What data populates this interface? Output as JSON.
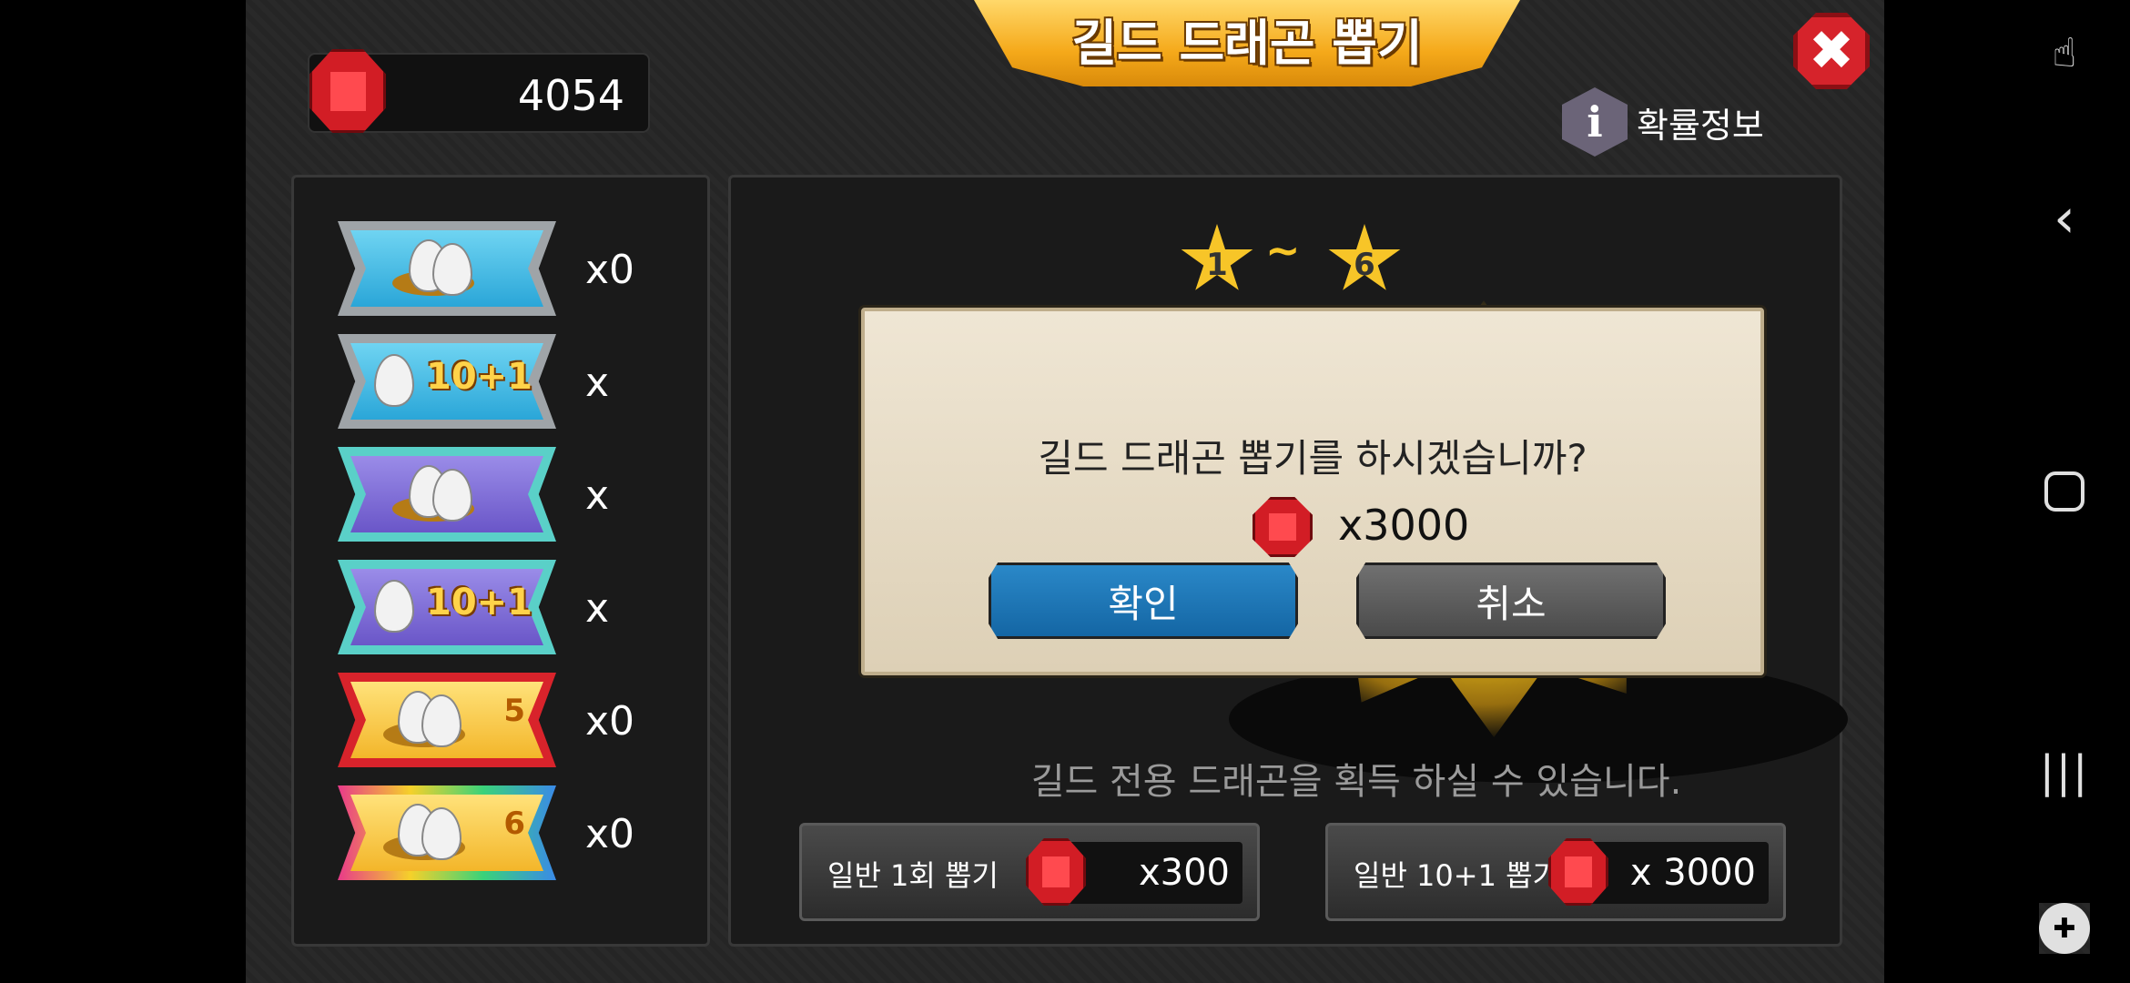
{
  "header": {
    "title": "길드 드래곤 뽑기",
    "close_label": "✖",
    "info_label": "확률정보",
    "info_icon_glyph": "i"
  },
  "currency": {
    "gem_count": "4054"
  },
  "tickets": [
    {
      "type": "single",
      "theme": "blue",
      "count": "x0"
    },
    {
      "type": "10+1",
      "theme": "blue",
      "badge": "10+1",
      "count": "x"
    },
    {
      "type": "single",
      "theme": "purple",
      "count": "x"
    },
    {
      "type": "10+1",
      "theme": "purple",
      "badge": "10+1",
      "count": "x"
    },
    {
      "type": "star5",
      "theme": "red",
      "star": "5",
      "count": "x0"
    },
    {
      "type": "star6",
      "theme": "rainbow",
      "star": "6",
      "count": "x0"
    }
  ],
  "main": {
    "star_min": "1",
    "star_sep": "~",
    "star_max": "6",
    "description": "길드 전용 드래곤을 획득 하실 수 있습니다.",
    "buttons": [
      {
        "label": "일반 1회 뽑기",
        "price": "x300"
      },
      {
        "label": "일반 10+1 뽑기",
        "price": "x 3000"
      }
    ]
  },
  "dialog": {
    "question": "길드 드래곤 뽑기를 하시겠습니까?",
    "cost": "x3000",
    "confirm_label": "확인",
    "cancel_label": "취소"
  },
  "navbar": {
    "touch_icon": "☝",
    "back_icon": "‹",
    "recent_icon": "|||",
    "game_icon": "✚"
  },
  "colors": {
    "banner": "#f5a91a",
    "gem": "#d21d25",
    "confirm": "#1466a4",
    "cancel": "#4a4a4a",
    "star": "#f7c528"
  }
}
